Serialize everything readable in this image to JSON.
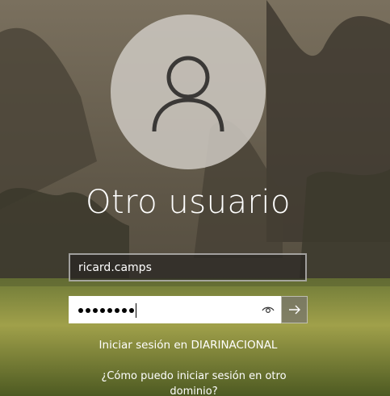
{
  "login": {
    "account_name": "Otro usuario",
    "username_value": "ricard.camps",
    "password_mask_count": 8,
    "domain_text": "Iniciar sesión en DIARINACIONAL",
    "help_link": "¿Cómo puedo iniciar sesión en otro dominio?"
  },
  "icons": {
    "avatar": "user-silhouette-icon",
    "reveal": "eye-icon",
    "submit": "arrow-right-icon"
  },
  "colors": {
    "avatar_circle": "#cdc8c1",
    "password_bg": "#ffffff",
    "username_bg": "#282622"
  }
}
